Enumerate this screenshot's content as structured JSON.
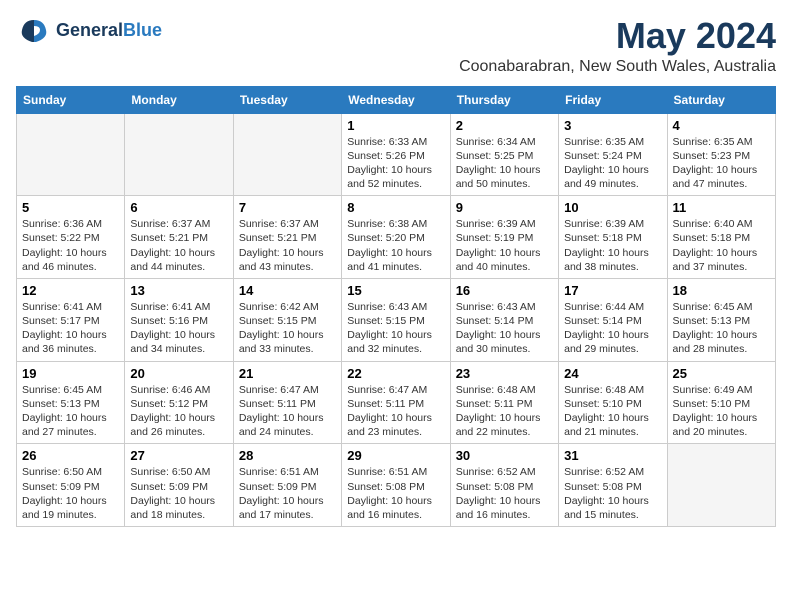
{
  "header": {
    "logo_line1": "General",
    "logo_line2": "Blue",
    "month": "May 2024",
    "location": "Coonabarabran, New South Wales, Australia"
  },
  "weekdays": [
    "Sunday",
    "Monday",
    "Tuesday",
    "Wednesday",
    "Thursday",
    "Friday",
    "Saturday"
  ],
  "weeks": [
    [
      {
        "day": "",
        "info": ""
      },
      {
        "day": "",
        "info": ""
      },
      {
        "day": "",
        "info": ""
      },
      {
        "day": "1",
        "info": "Sunrise: 6:33 AM\nSunset: 5:26 PM\nDaylight: 10 hours and 52 minutes."
      },
      {
        "day": "2",
        "info": "Sunrise: 6:34 AM\nSunset: 5:25 PM\nDaylight: 10 hours and 50 minutes."
      },
      {
        "day": "3",
        "info": "Sunrise: 6:35 AM\nSunset: 5:24 PM\nDaylight: 10 hours and 49 minutes."
      },
      {
        "day": "4",
        "info": "Sunrise: 6:35 AM\nSunset: 5:23 PM\nDaylight: 10 hours and 47 minutes."
      }
    ],
    [
      {
        "day": "5",
        "info": "Sunrise: 6:36 AM\nSunset: 5:22 PM\nDaylight: 10 hours and 46 minutes."
      },
      {
        "day": "6",
        "info": "Sunrise: 6:37 AM\nSunset: 5:21 PM\nDaylight: 10 hours and 44 minutes."
      },
      {
        "day": "7",
        "info": "Sunrise: 6:37 AM\nSunset: 5:21 PM\nDaylight: 10 hours and 43 minutes."
      },
      {
        "day": "8",
        "info": "Sunrise: 6:38 AM\nSunset: 5:20 PM\nDaylight: 10 hours and 41 minutes."
      },
      {
        "day": "9",
        "info": "Sunrise: 6:39 AM\nSunset: 5:19 PM\nDaylight: 10 hours and 40 minutes."
      },
      {
        "day": "10",
        "info": "Sunrise: 6:39 AM\nSunset: 5:18 PM\nDaylight: 10 hours and 38 minutes."
      },
      {
        "day": "11",
        "info": "Sunrise: 6:40 AM\nSunset: 5:18 PM\nDaylight: 10 hours and 37 minutes."
      }
    ],
    [
      {
        "day": "12",
        "info": "Sunrise: 6:41 AM\nSunset: 5:17 PM\nDaylight: 10 hours and 36 minutes."
      },
      {
        "day": "13",
        "info": "Sunrise: 6:41 AM\nSunset: 5:16 PM\nDaylight: 10 hours and 34 minutes."
      },
      {
        "day": "14",
        "info": "Sunrise: 6:42 AM\nSunset: 5:15 PM\nDaylight: 10 hours and 33 minutes."
      },
      {
        "day": "15",
        "info": "Sunrise: 6:43 AM\nSunset: 5:15 PM\nDaylight: 10 hours and 32 minutes."
      },
      {
        "day": "16",
        "info": "Sunrise: 6:43 AM\nSunset: 5:14 PM\nDaylight: 10 hours and 30 minutes."
      },
      {
        "day": "17",
        "info": "Sunrise: 6:44 AM\nSunset: 5:14 PM\nDaylight: 10 hours and 29 minutes."
      },
      {
        "day": "18",
        "info": "Sunrise: 6:45 AM\nSunset: 5:13 PM\nDaylight: 10 hours and 28 minutes."
      }
    ],
    [
      {
        "day": "19",
        "info": "Sunrise: 6:45 AM\nSunset: 5:13 PM\nDaylight: 10 hours and 27 minutes."
      },
      {
        "day": "20",
        "info": "Sunrise: 6:46 AM\nSunset: 5:12 PM\nDaylight: 10 hours and 26 minutes."
      },
      {
        "day": "21",
        "info": "Sunrise: 6:47 AM\nSunset: 5:11 PM\nDaylight: 10 hours and 24 minutes."
      },
      {
        "day": "22",
        "info": "Sunrise: 6:47 AM\nSunset: 5:11 PM\nDaylight: 10 hours and 23 minutes."
      },
      {
        "day": "23",
        "info": "Sunrise: 6:48 AM\nSunset: 5:11 PM\nDaylight: 10 hours and 22 minutes."
      },
      {
        "day": "24",
        "info": "Sunrise: 6:48 AM\nSunset: 5:10 PM\nDaylight: 10 hours and 21 minutes."
      },
      {
        "day": "25",
        "info": "Sunrise: 6:49 AM\nSunset: 5:10 PM\nDaylight: 10 hours and 20 minutes."
      }
    ],
    [
      {
        "day": "26",
        "info": "Sunrise: 6:50 AM\nSunset: 5:09 PM\nDaylight: 10 hours and 19 minutes."
      },
      {
        "day": "27",
        "info": "Sunrise: 6:50 AM\nSunset: 5:09 PM\nDaylight: 10 hours and 18 minutes."
      },
      {
        "day": "28",
        "info": "Sunrise: 6:51 AM\nSunset: 5:09 PM\nDaylight: 10 hours and 17 minutes."
      },
      {
        "day": "29",
        "info": "Sunrise: 6:51 AM\nSunset: 5:08 PM\nDaylight: 10 hours and 16 minutes."
      },
      {
        "day": "30",
        "info": "Sunrise: 6:52 AM\nSunset: 5:08 PM\nDaylight: 10 hours and 16 minutes."
      },
      {
        "day": "31",
        "info": "Sunrise: 6:52 AM\nSunset: 5:08 PM\nDaylight: 10 hours and 15 minutes."
      },
      {
        "day": "",
        "info": ""
      }
    ]
  ]
}
